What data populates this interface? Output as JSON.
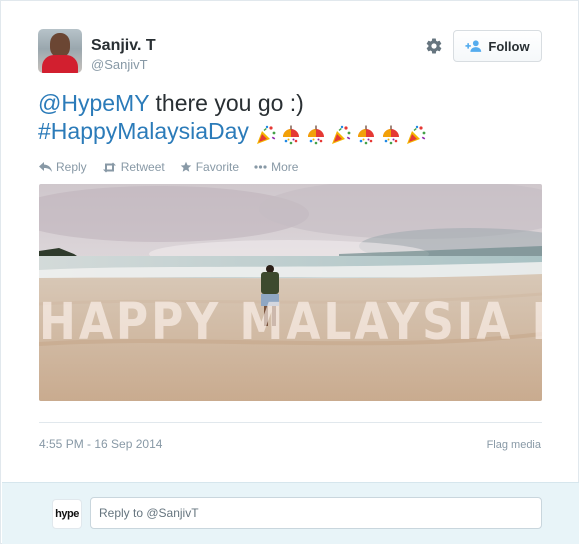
{
  "author": {
    "name": "Sanjiv. T",
    "handle": "@SanjivT"
  },
  "follow_button": {
    "label": "Follow"
  },
  "tweet": {
    "mention": "@HypeMY",
    "text_after_mention": " there you go :)",
    "hashtag": "#HappyMalaysiaDay",
    "emoji_sequence": [
      "party-popper",
      "confetti-ball",
      "confetti-ball",
      "party-popper",
      "confetti-ball",
      "confetti-ball",
      "party-popper"
    ]
  },
  "actions": [
    {
      "label": "Reply",
      "icon": "reply-icon"
    },
    {
      "label": "Retweet",
      "icon": "retweet-icon"
    },
    {
      "label": "Favorite",
      "icon": "star-icon"
    },
    {
      "label": "More",
      "icon": "more-icon"
    }
  ],
  "media": {
    "overlay_text": "HAPPY MALAYSIA DAY"
  },
  "timestamp": "4:55 PM - 16 Sep 2014",
  "flag_media": "Flag media",
  "reply_box": {
    "logo_text": "hype",
    "value": "Reply to @SanjivT"
  },
  "colors": {
    "link": "#2b7bb9",
    "muted": "#8899a6",
    "reply_bg": "#e8f4f8"
  }
}
